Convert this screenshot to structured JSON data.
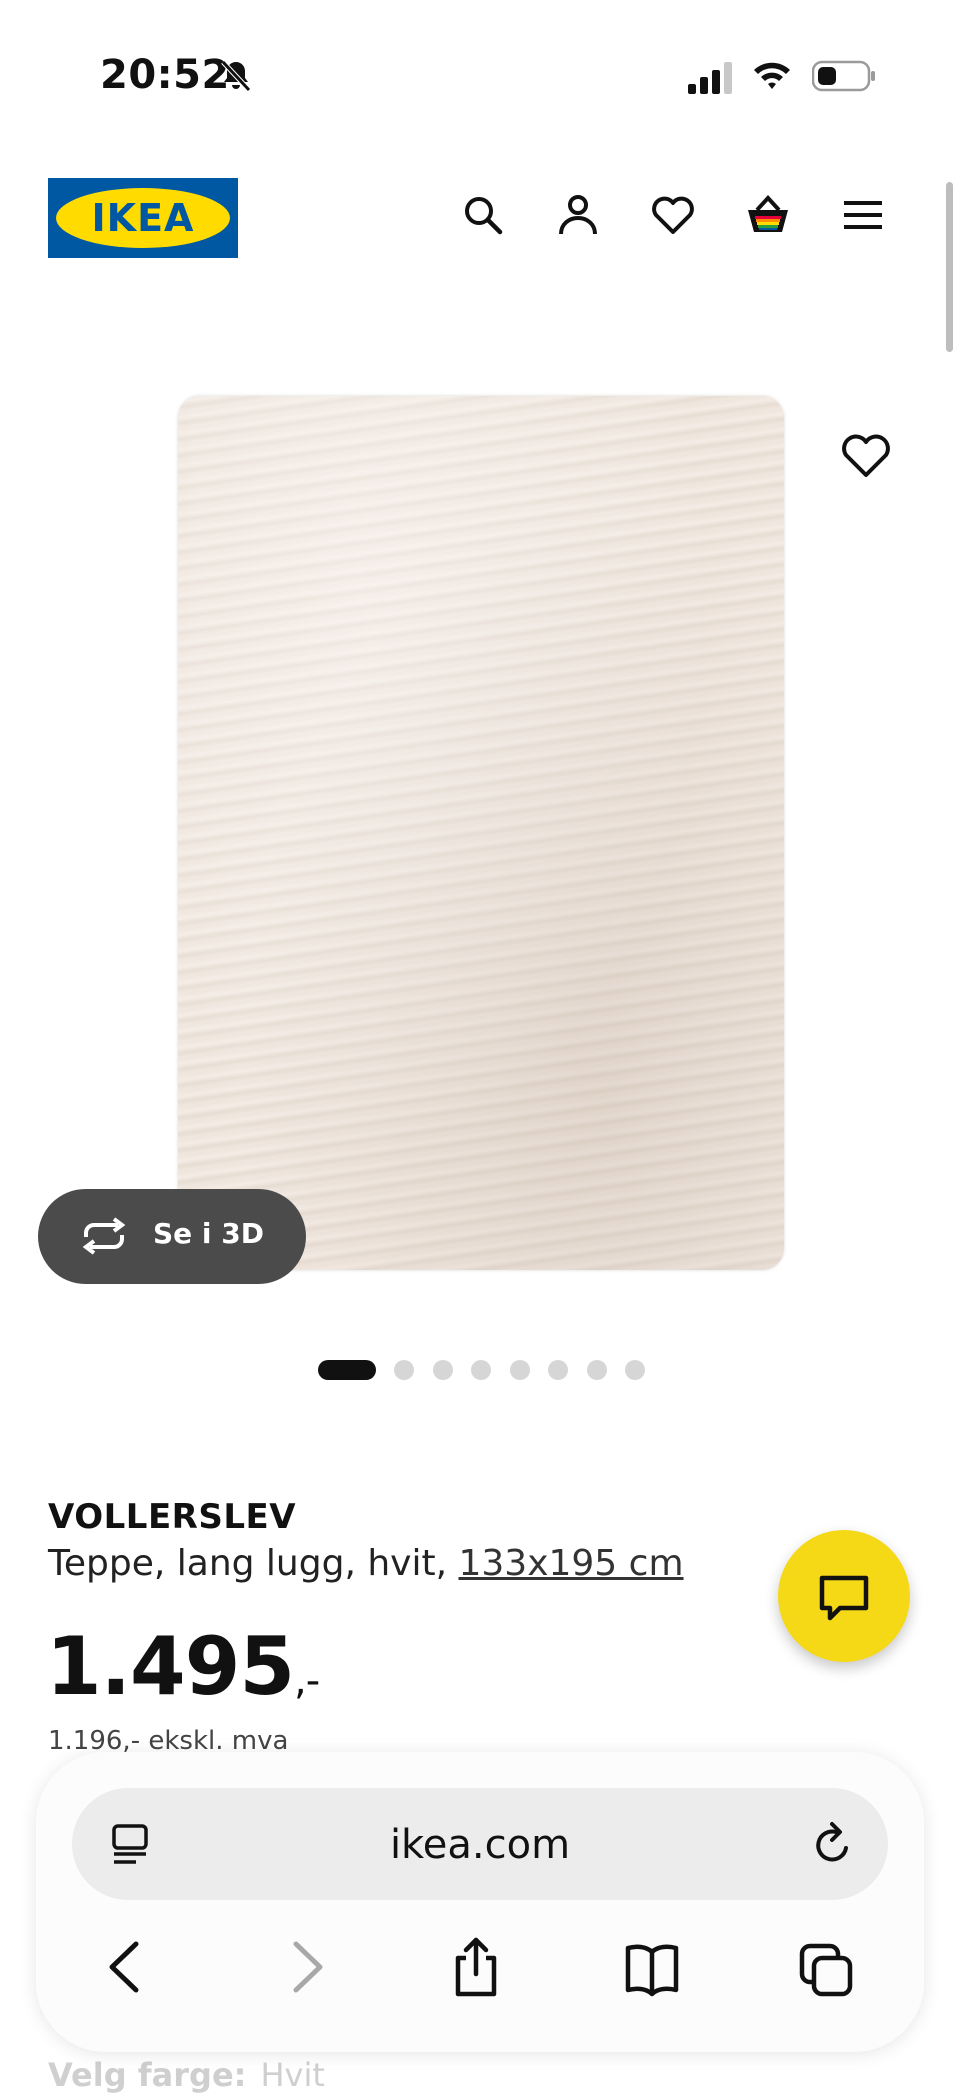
{
  "status_bar": {
    "time": "20:52",
    "icons": [
      "bell-slash-icon",
      "cellular-signal-icon",
      "wifi-icon",
      "battery-icon"
    ]
  },
  "header": {
    "logo_text": "IKEA",
    "icons": [
      "search-icon",
      "account-icon",
      "wishlist-icon",
      "shopping-bag-icon",
      "menu-icon"
    ],
    "colors": {
      "logo_blue": "#0058a3",
      "logo_yellow": "#ffdb00"
    }
  },
  "gallery": {
    "image": "product-photo-rug",
    "favourite_icon": "heart-icon",
    "view_3d_label": "Se i 3D",
    "dots_total": 8,
    "active_dot": 1
  },
  "product": {
    "name": "VOLLERSLEV",
    "description": "Teppe, lang lugg, hvit,",
    "size": "133x195 cm",
    "price": "1.495",
    "price_suffix": ",-",
    "price_ex_vat": "1.196,- ekskl. mva",
    "color_label": "Velg farge:",
    "color_value": "Hvit"
  },
  "chat": {
    "icon": "chat-icon",
    "color": "#f5d917"
  },
  "browser": {
    "url": "ikea.com",
    "buttons": [
      "reader-icon",
      "reload-icon",
      "back-icon",
      "forward-icon",
      "share-icon",
      "bookmarks-icon",
      "tabs-icon"
    ]
  }
}
